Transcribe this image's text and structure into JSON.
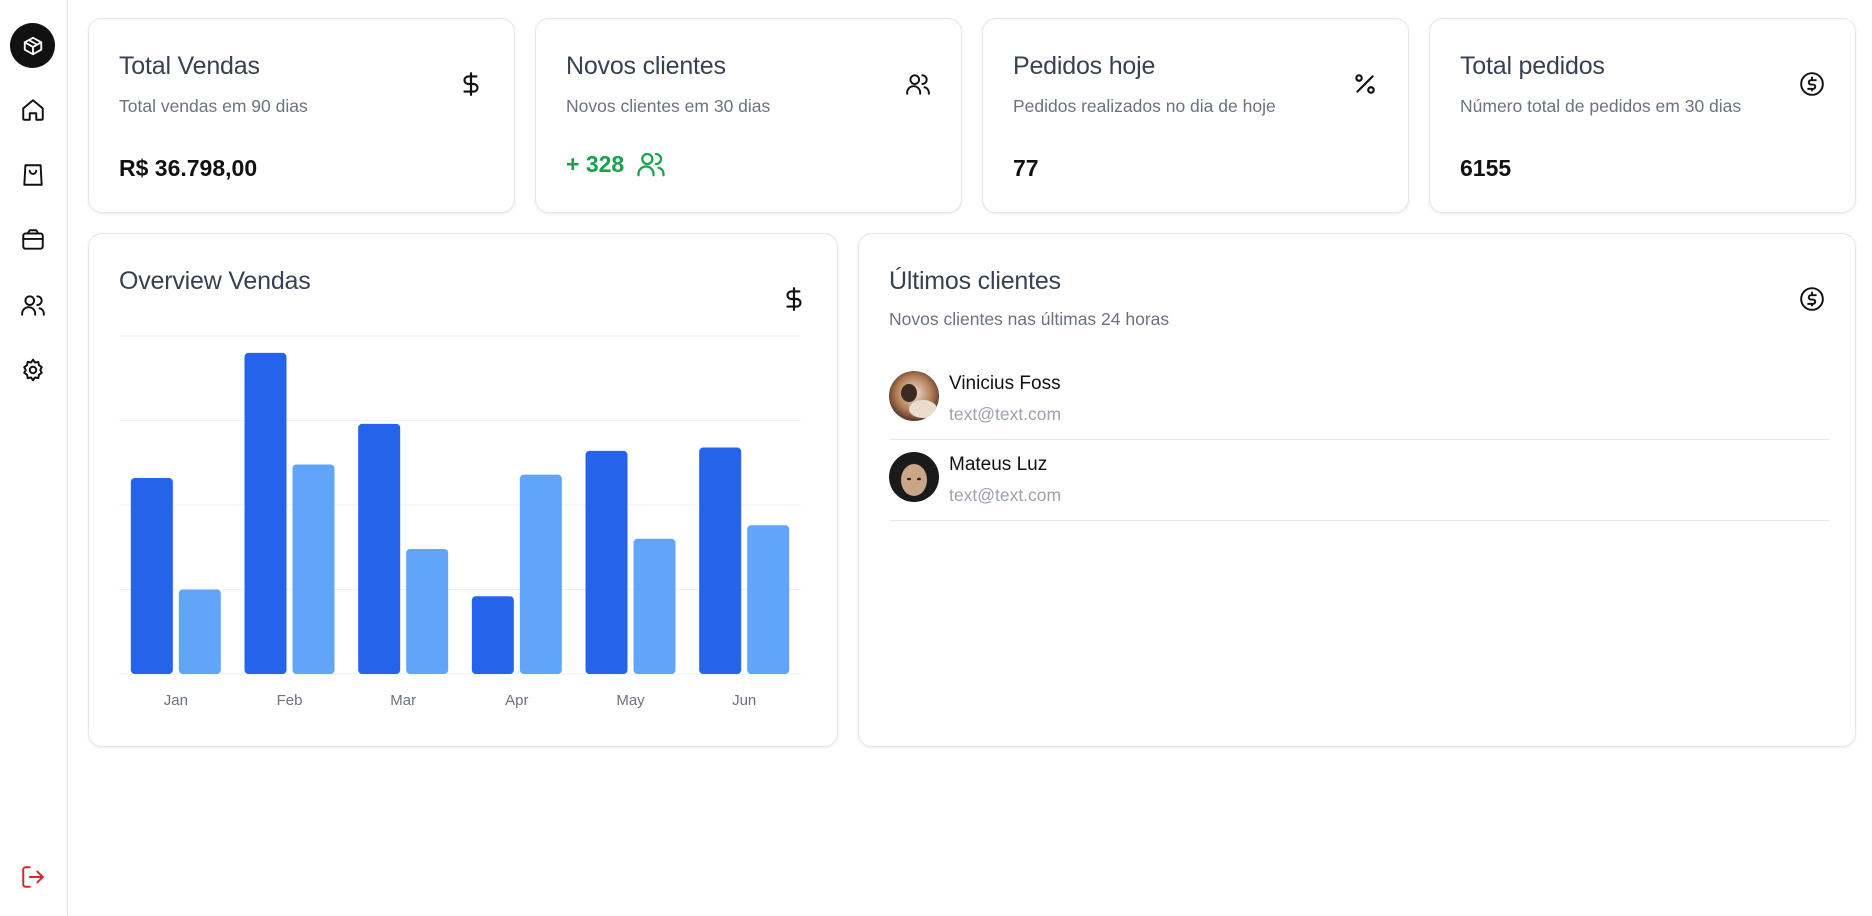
{
  "sidebar": {
    "items": [
      {
        "icon": "package-icon",
        "active": true
      },
      {
        "icon": "home-icon"
      },
      {
        "icon": "shopping-bag-icon"
      },
      {
        "icon": "archive-icon"
      },
      {
        "icon": "users-icon"
      },
      {
        "icon": "settings-icon"
      },
      {
        "icon": "logout-icon"
      }
    ]
  },
  "stats": [
    {
      "title": "Total Vendas",
      "subtitle": "Total vendas em 90 dias",
      "value": "R$ 36.798,00",
      "icon": "dollar-sign-icon"
    },
    {
      "title": "Novos clientes",
      "subtitle": "Novos clientes em 30 dias",
      "value": "+ 328",
      "icon": "users-icon",
      "value_color": "#16a34a"
    },
    {
      "title": "Pedidos hoje",
      "subtitle": "Pedidos realizados no dia de hoje",
      "value": "77",
      "icon": "percent-icon"
    },
    {
      "title": "Total pedidos",
      "subtitle": "Número total de pedidos em 30 dias",
      "value": "6155",
      "icon": "circle-dollar-icon"
    }
  ],
  "overview": {
    "title": "Overview Vendas",
    "icon": "dollar-sign-icon"
  },
  "chart_data": {
    "type": "bar",
    "categories": [
      "Jan",
      "Feb",
      "Mar",
      "Apr",
      "May",
      "Jun"
    ],
    "series": [
      {
        "values": [
          58,
          95,
          74,
          23,
          66,
          67
        ],
        "color": "#2563eb"
      },
      {
        "values": [
          25,
          62,
          37,
          59,
          40,
          44
        ],
        "color": "#60a5fa"
      }
    ],
    "ylim": [
      0,
      100
    ],
    "grid": true,
    "title": "",
    "xlabel": "",
    "ylabel": ""
  },
  "clients": {
    "title": "Últimos clientes",
    "subtitle": "Novos clientes nas últimas 24 horas",
    "icon": "circle-dollar-icon",
    "items": [
      {
        "name": "Vinicius Foss",
        "email": "text@text.com"
      },
      {
        "name": "Mateus Luz",
        "email": "text@text.com"
      }
    ]
  },
  "colors": {
    "primary_bar": "#2563eb",
    "secondary_bar": "#60a5fa",
    "positive": "#16a34a",
    "logout": "#dc2626"
  }
}
